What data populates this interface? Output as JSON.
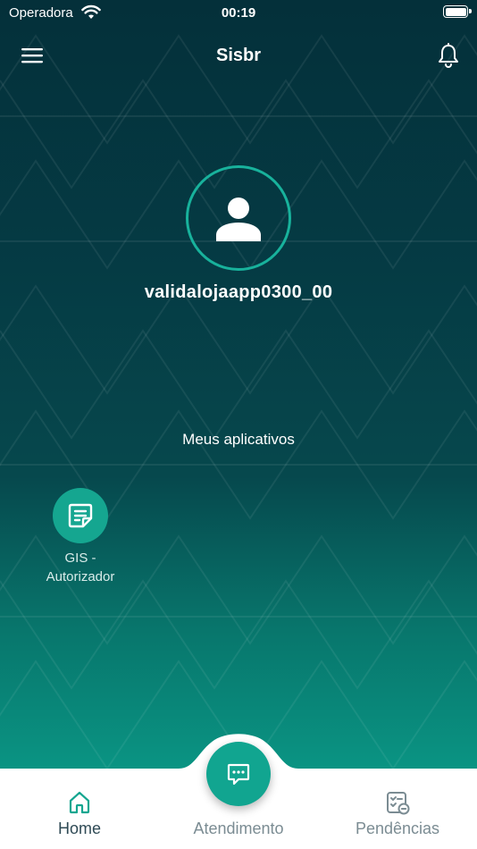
{
  "status_bar": {
    "carrier": "Operadora",
    "time": "00:19"
  },
  "nav": {
    "title": "Sisbr"
  },
  "profile": {
    "username": "validalojaapp0300_00"
  },
  "apps": {
    "section_title": "Meus aplicativos",
    "items": [
      {
        "label": "GIS -\nAutorizador",
        "icon": "document-icon"
      }
    ]
  },
  "tabs": [
    {
      "label": "Home",
      "icon": "home-icon",
      "active": true
    },
    {
      "label": "Atendimento",
      "icon": "chat-icon",
      "active": false
    },
    {
      "label": "Pendências",
      "icon": "checklist-icon",
      "active": false
    }
  ],
  "colors": {
    "accent": "#15a690",
    "ring": "#18b29c",
    "background_top": "#04303a",
    "background_bottom": "#0a9483"
  }
}
